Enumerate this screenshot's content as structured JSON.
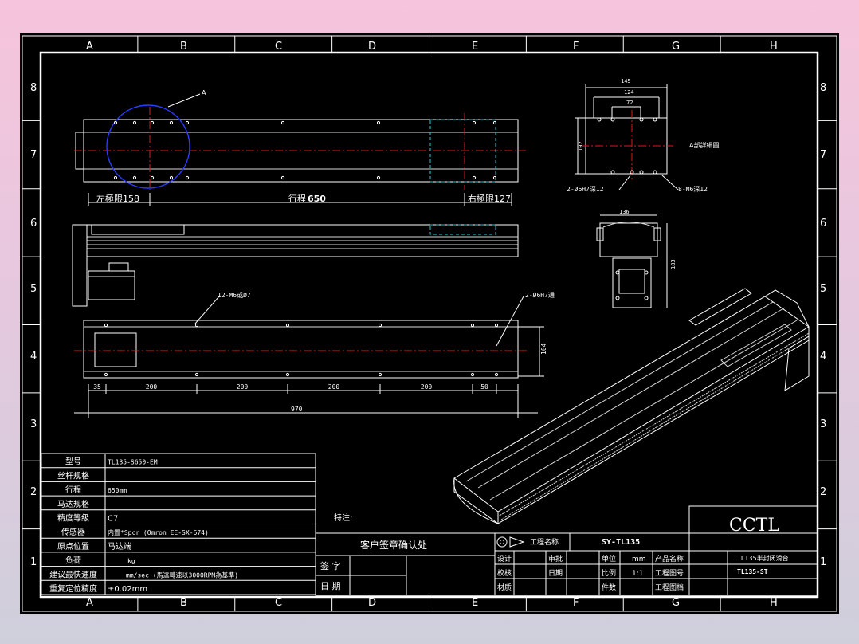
{
  "zones": {
    "cols": [
      "A",
      "B",
      "C",
      "D",
      "E",
      "F",
      "G",
      "H"
    ],
    "rows": [
      "8",
      "7",
      "6",
      "5",
      "4",
      "3",
      "2",
      "1"
    ]
  },
  "top_view": {
    "callout": "A",
    "left_limit": "左極限158",
    "stroke": "行程",
    "stroke_value": "650",
    "right_limit": "右極限127"
  },
  "end_view": {
    "dim_width": "145",
    "dim_inner": "124",
    "dim_holes": "72",
    "dim_height": "102",
    "detail_label": "A部詳細圖",
    "note_pin": "2-Ø6H7深12",
    "note_tap": "8-M6深12"
  },
  "end_view2": {
    "dim_width": "136",
    "dim_height": "183"
  },
  "bottom_view": {
    "note_holes": "12-M6或Ø7",
    "note_pins": "2-Ø6H7通",
    "dim_height": "104",
    "dims": [
      "35",
      "200",
      "200",
      "200",
      "200",
      "50"
    ],
    "overall": "970"
  },
  "spec_table": {
    "rows": [
      {
        "label": "型号",
        "value": "TL135-S650-EM"
      },
      {
        "label": "丝杆规格",
        "value": ""
      },
      {
        "label": "行程",
        "value": "650mm"
      },
      {
        "label": "马达规格",
        "value": ""
      },
      {
        "label": "精度等级",
        "value": "C7"
      },
      {
        "label": "传感器",
        "value": "内置*Spcr (Omron EE-SX-674)"
      },
      {
        "label": "原点位置",
        "value": "马达端"
      },
      {
        "label": "负荷",
        "value": "kg"
      },
      {
        "label": "建议最快速度",
        "value": "mm/sec (馬達轉速以3000RPM為基準)"
      },
      {
        "label": "重复定位精度",
        "value": "±0.02mm"
      }
    ]
  },
  "remarks_label": "特注:",
  "signoff": {
    "title": "客户签章确认处",
    "sign": "签 字",
    "date": "日 期"
  },
  "title_block": {
    "project_label": "工程名称",
    "drawing_no": "SY-TL135",
    "logo": "CCTL",
    "product_name_value": "TL135半封闭滑台",
    "product_code_value": "TL135-ST",
    "rows": [
      [
        "设计",
        "",
        "审批",
        "",
        "单位",
        "mm",
        "产品名称"
      ],
      [
        "校核",
        "",
        "日期",
        "",
        "比例",
        "1:1",
        "工程图号"
      ],
      [
        "材质",
        "",
        "",
        "",
        "件数",
        "",
        "工程图档"
      ]
    ]
  }
}
